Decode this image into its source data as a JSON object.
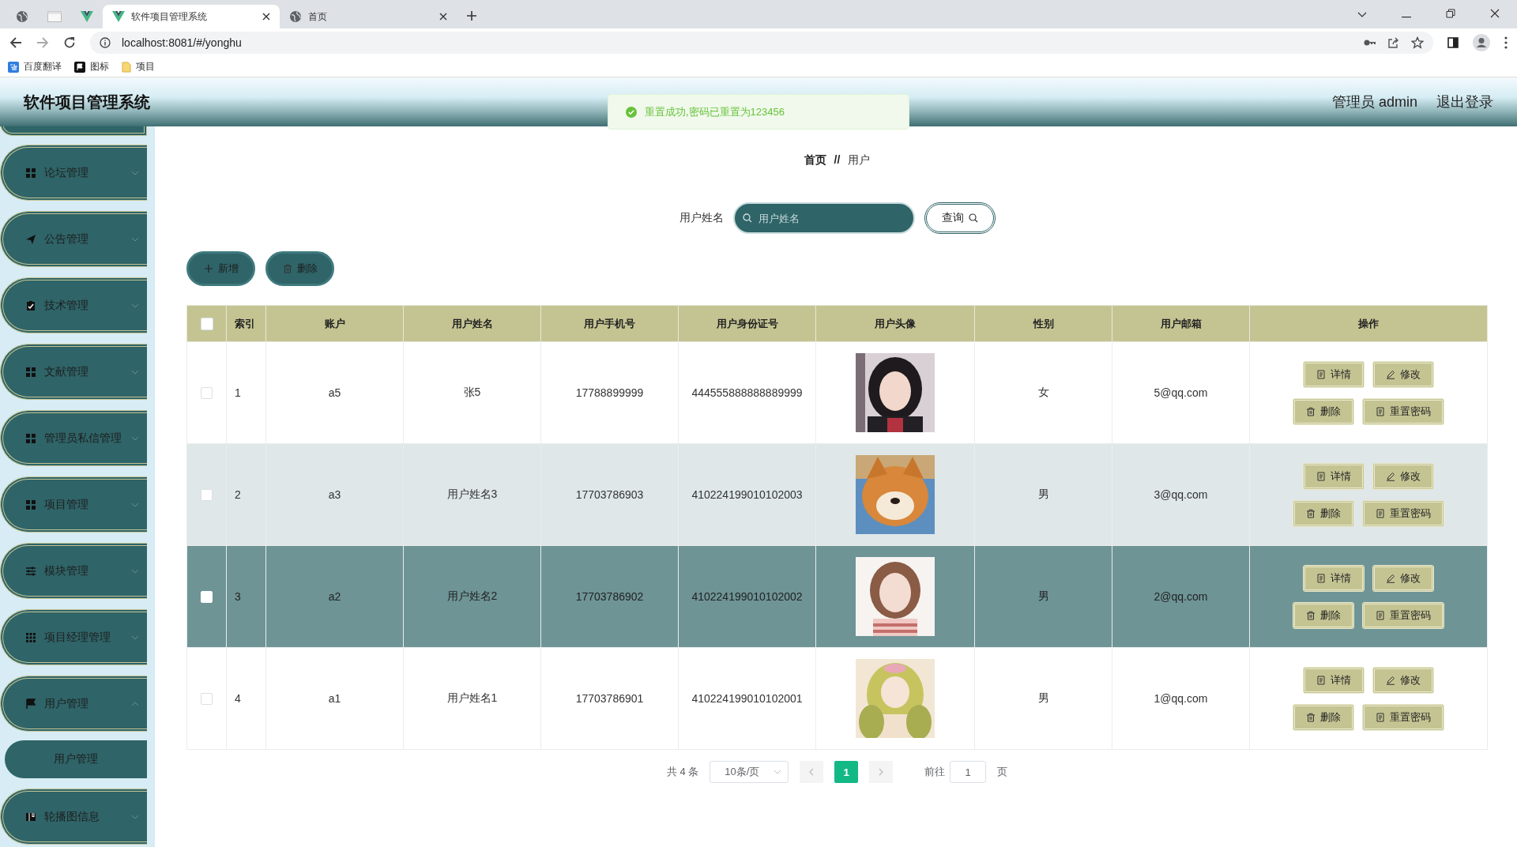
{
  "browser": {
    "tabs": [
      {
        "kind": "globe",
        "selected": false
      },
      {
        "kind": "blank",
        "selected": false
      },
      {
        "kind": "vue",
        "selected": false
      },
      {
        "kind": "vue",
        "title": "软件项目管理系统",
        "selected": true
      },
      {
        "kind": "globe",
        "title": "首页",
        "selected": false
      }
    ],
    "url": "localhost:8081/#/yonghu",
    "bookmarks": [
      {
        "kind": "translate",
        "label": "百度翻译"
      },
      {
        "kind": "flag",
        "label": "图标"
      },
      {
        "kind": "folder",
        "label": "项目"
      }
    ]
  },
  "header": {
    "title": "软件项目管理系统",
    "user": "管理员 admin",
    "logout": "退出登录"
  },
  "toast": {
    "message": "重置成功,密码已重置为123456"
  },
  "sidebar": {
    "items": [
      {
        "label": "论坛管理",
        "expanded": false
      },
      {
        "label": "公告管理",
        "expanded": false
      },
      {
        "label": "技术管理",
        "expanded": false
      },
      {
        "label": "文献管理",
        "expanded": false
      },
      {
        "label": "管理员私信管理",
        "expanded": false
      },
      {
        "label": "项目管理",
        "expanded": false
      },
      {
        "label": "模块管理",
        "expanded": false
      },
      {
        "label": "项目经理管理",
        "expanded": false
      },
      {
        "label": "用户管理",
        "expanded": true,
        "children": [
          {
            "label": "用户管理"
          }
        ]
      },
      {
        "label": "轮播图信息",
        "expanded": false
      }
    ]
  },
  "breadcrumb": {
    "items": [
      "首页",
      "用户"
    ],
    "separator": "//"
  },
  "search": {
    "label": "用户姓名",
    "placeholder": "用户姓名",
    "button": "查询"
  },
  "actions": [
    {
      "kind": "add",
      "label": "新增"
    },
    {
      "kind": "delete",
      "label": "删除"
    }
  ],
  "table": {
    "select_all": {
      "checked": false
    },
    "columns": [
      "索引",
      "账户",
      "用户姓名",
      "用户手机号",
      "用户身份证号",
      "用户头像",
      "性别",
      "用户邮箱",
      "操作"
    ],
    "rows": [
      {
        "index": "1",
        "account": "a5",
        "name": "张5",
        "phone": "17788899999",
        "id_number": "444555888888889999",
        "avatar": {
          "kind": "picture"
        },
        "gender": "女",
        "email": "5@qq.com",
        "checked": false,
        "selected": false,
        "hovered": false,
        "actions": [
          {
            "kind": "detail",
            "label": "详情"
          },
          {
            "kind": "edit",
            "label": "修改"
          },
          {
            "kind": "delete",
            "label": "删除"
          },
          {
            "kind": "reset",
            "label": "重置密码"
          }
        ]
      },
      {
        "index": "2",
        "account": "a3",
        "name": "用户姓名3",
        "phone": "17703786903",
        "id_number": "410224199010102003",
        "avatar": {
          "kind": "picture"
        },
        "gender": "男",
        "email": "3@qq.com",
        "checked": false,
        "selected": false,
        "hovered": true,
        "actions": [
          {
            "kind": "detail",
            "label": "详情"
          },
          {
            "kind": "edit",
            "label": "修改"
          },
          {
            "kind": "delete",
            "label": "删除"
          },
          {
            "kind": "reset",
            "label": "重置密码"
          }
        ]
      },
      {
        "index": "3",
        "account": "a2",
        "name": "用户姓名2",
        "phone": "17703786902",
        "id_number": "410224199010102002",
        "avatar": {
          "kind": "picture"
        },
        "gender": "男",
        "email": "2@qq.com",
        "checked": false,
        "selected": true,
        "hovered": false,
        "actions": [
          {
            "kind": "detail",
            "label": "详情"
          },
          {
            "kind": "edit",
            "label": "修改"
          },
          {
            "kind": "delete",
            "label": "删除"
          },
          {
            "kind": "reset",
            "label": "重置密码"
          }
        ]
      },
      {
        "index": "4",
        "account": "a1",
        "name": "用户姓名1",
        "phone": "17703786901",
        "id_number": "410224199010102001",
        "avatar": {
          "kind": "picture"
        },
        "gender": "男",
        "email": "1@qq.com",
        "checked": false,
        "selected": false,
        "hovered": false,
        "actions": [
          {
            "kind": "detail",
            "label": "详情"
          },
          {
            "kind": "edit",
            "label": "修改"
          },
          {
            "kind": "delete",
            "label": "删除"
          },
          {
            "kind": "reset",
            "label": "重置密码"
          }
        ]
      }
    ]
  },
  "pagination": {
    "total": "共 4 条",
    "page_size": "10条/页",
    "pages": [
      {
        "label": "1",
        "selected": true
      }
    ],
    "goto_label": "前往",
    "goto_value": "1",
    "goto_suffix": "页"
  }
}
